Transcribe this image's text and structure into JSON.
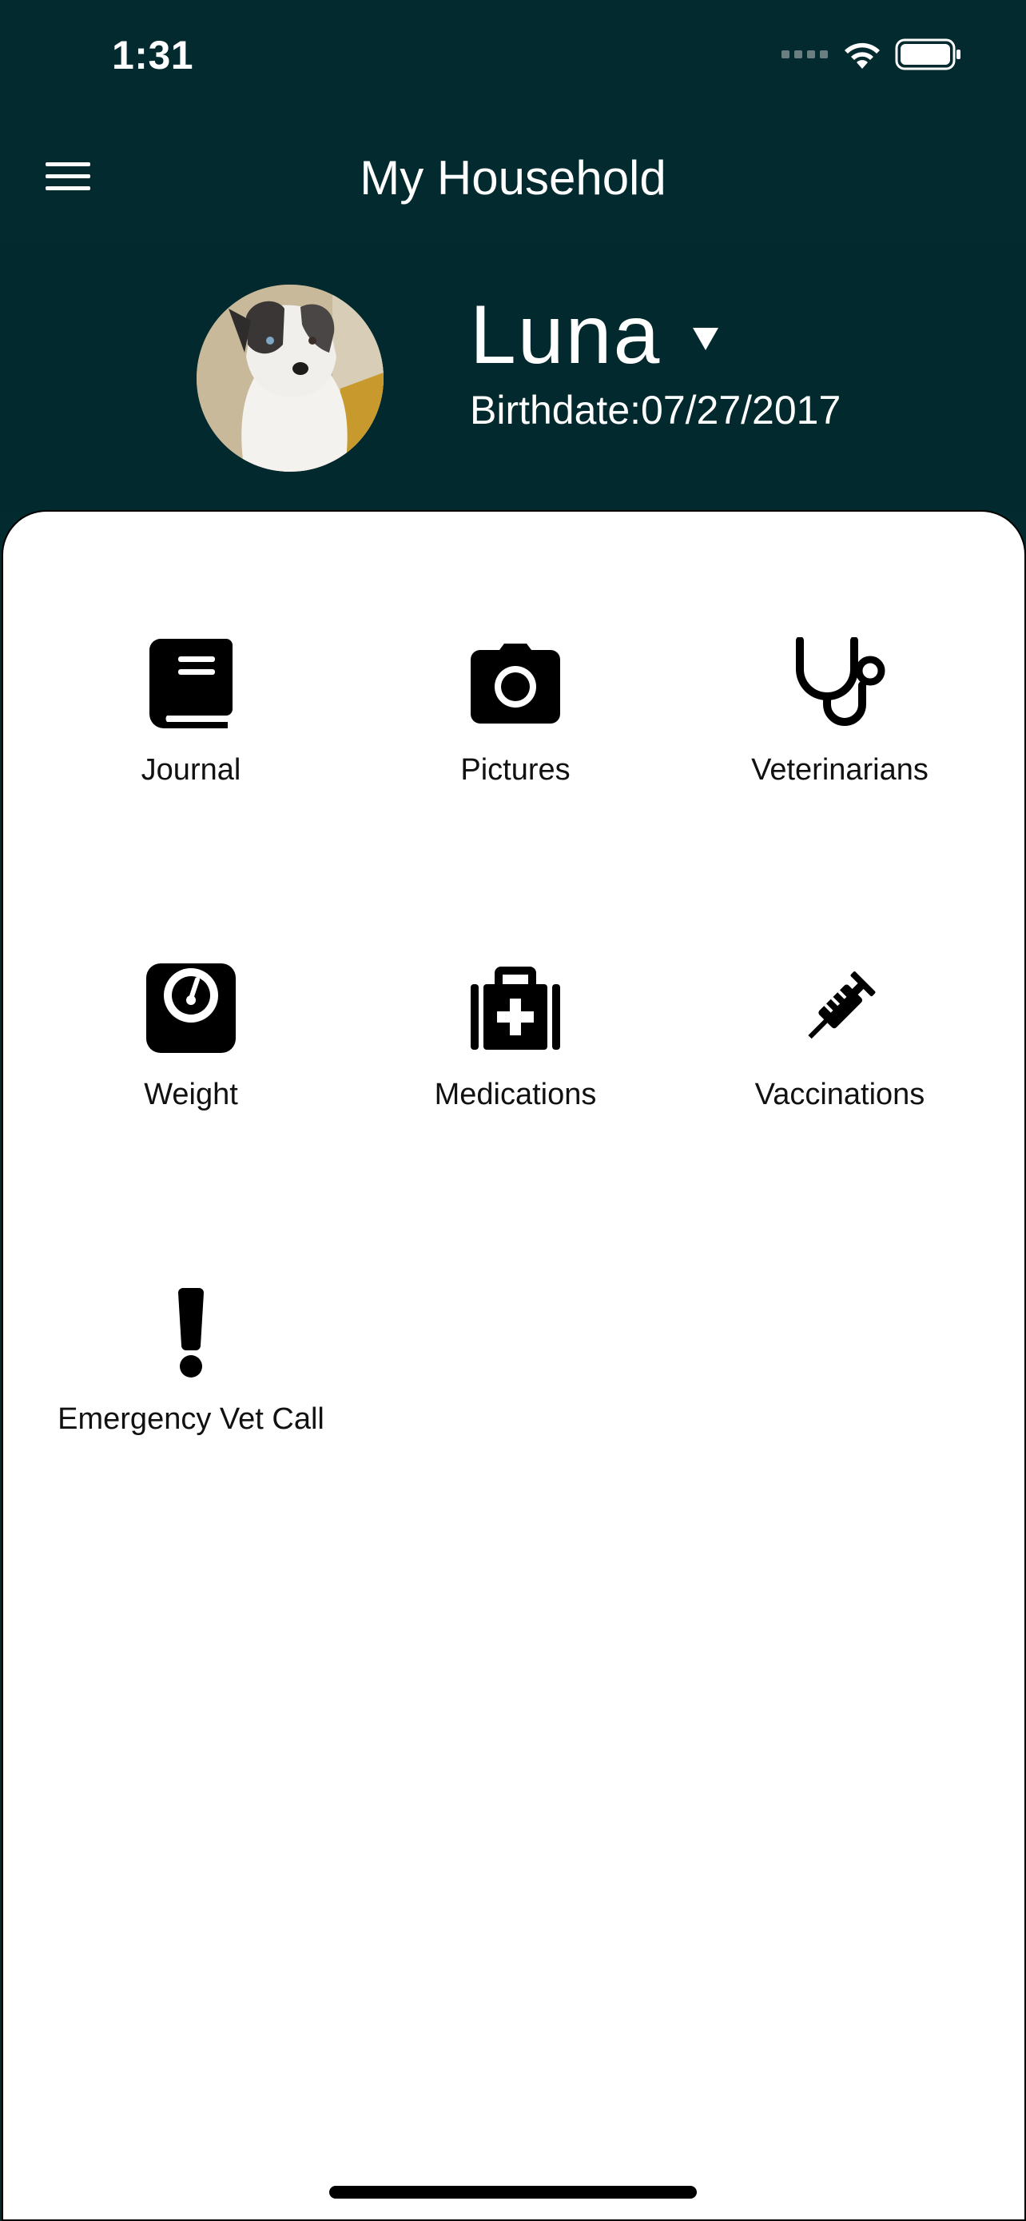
{
  "status_bar": {
    "time": "1:31",
    "icons": [
      "cellular-signal-icon",
      "wifi-icon",
      "battery-icon"
    ]
  },
  "header": {
    "title": "My Household",
    "menu_icon": "hamburger-menu-icon"
  },
  "pet": {
    "name": "Luna",
    "birthdate_label": "Birthdate:07/27/2017",
    "dropdown_icon": "triangle-down-icon"
  },
  "tiles": [
    {
      "label": "Journal",
      "icon": "book-icon"
    },
    {
      "label": "Pictures",
      "icon": "camera-icon"
    },
    {
      "label": "Veterinarians",
      "icon": "stethoscope-icon"
    },
    {
      "label": "Weight",
      "icon": "scale-icon"
    },
    {
      "label": "Medications",
      "icon": "medical-kit-icon"
    },
    {
      "label": "Vaccinations",
      "icon": "syringe-icon"
    },
    {
      "label": "Emergency Vet Call",
      "icon": "exclamation-icon"
    }
  ],
  "colors": {
    "header_bg": "#032b2f",
    "card_bg": "#ffffff",
    "icon_color": "#000000"
  }
}
